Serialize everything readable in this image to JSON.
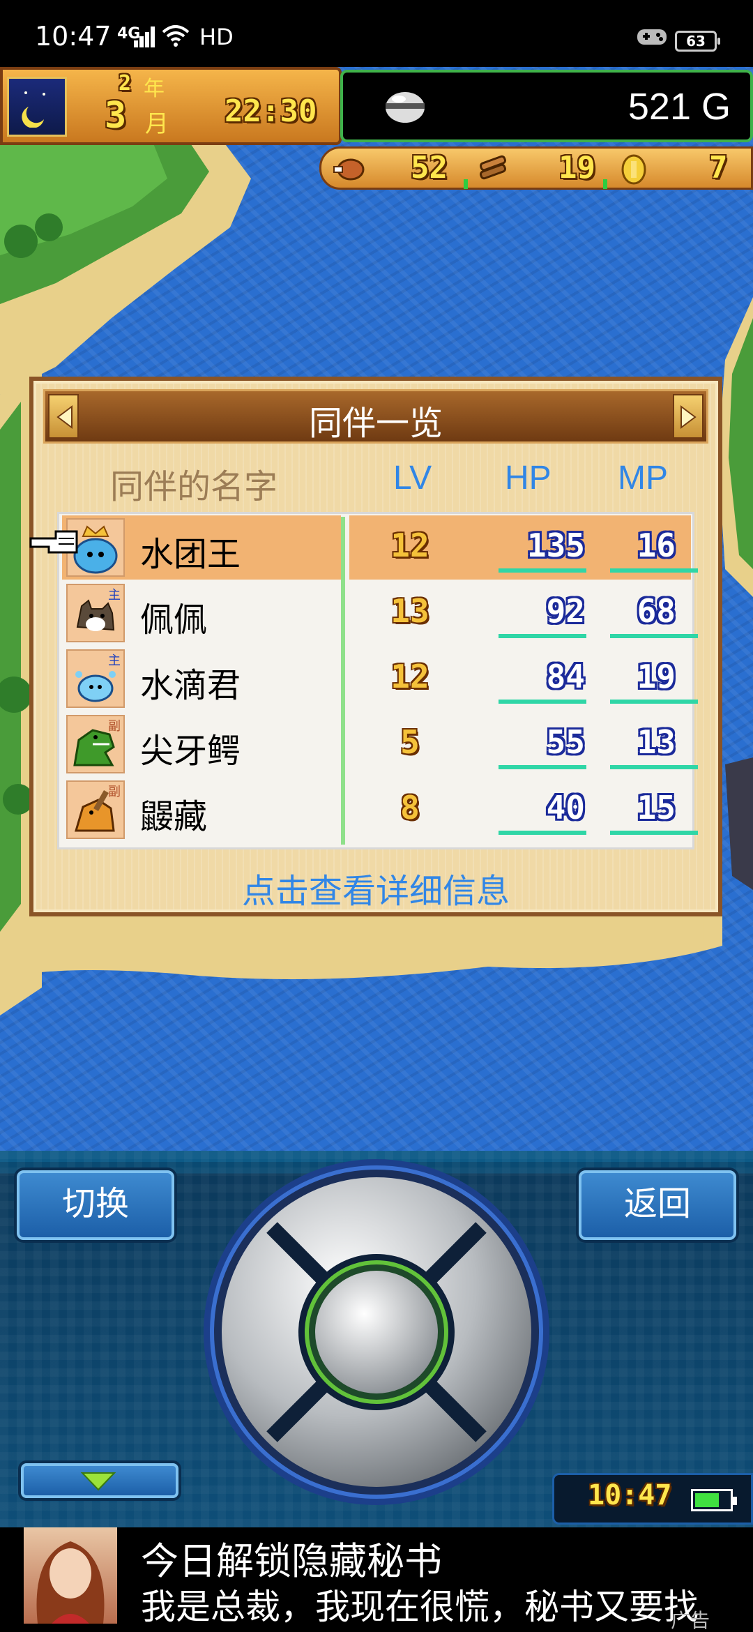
{
  "status_bar": {
    "time": "10:47",
    "network": "4G",
    "hd": "HD",
    "battery": "63"
  },
  "hud": {
    "year_num": "2",
    "year_unit": "年",
    "month_num": "3",
    "month_unit": "月",
    "clock": "22:30",
    "gold": "521 G",
    "resources": [
      {
        "icon": "meat-icon",
        "value": "52"
      },
      {
        "icon": "wood-icon",
        "value": "19"
      },
      {
        "icon": "coin-icon",
        "value": "7"
      }
    ]
  },
  "panel": {
    "title": "同伴一览",
    "col_name": "同伴的名字",
    "col_lv": "LV",
    "col_hp": "HP",
    "col_mp": "MP",
    "rows": [
      {
        "name": "水团王",
        "lv": "12",
        "hp": "135",
        "mp": "16",
        "tag": "",
        "selected": true
      },
      {
        "name": "佩佩",
        "lv": "13",
        "hp": "92",
        "mp": "68",
        "tag": "主"
      },
      {
        "name": "水滴君",
        "lv": "12",
        "hp": "84",
        "mp": "19",
        "tag": "主"
      },
      {
        "name": "尖牙鳄",
        "lv": "5",
        "hp": "55",
        "mp": "13",
        "tag": "副"
      },
      {
        "name": "鼹藏",
        "lv": "8",
        "hp": "40",
        "mp": "15",
        "tag": "副"
      }
    ],
    "detail_link": "点击查看详细信息"
  },
  "controller": {
    "switch_label": "切换",
    "back_label": "返回",
    "mini_time": "10:47"
  },
  "ad": {
    "title": "今日解锁隐藏秘书",
    "subtitle": "我是总裁，我现在很慌，秘书又要找",
    "label": "广告"
  },
  "colors": {
    "water": "#2a6fd0",
    "panel_bg": "#f0d9a6",
    "selection": "#f2b372",
    "accent_blue": "#3186e6",
    "hud_green": "#3fb24b"
  }
}
